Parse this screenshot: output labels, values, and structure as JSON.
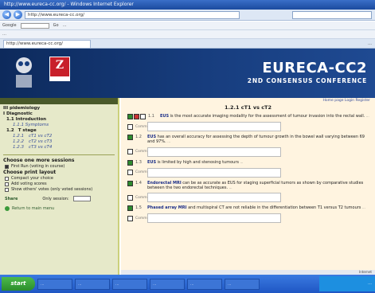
{
  "window": {
    "title": "http://www.eureca-cc.org/ - Windows Internet Explorer",
    "address": "http://www.eureca-cc.org/",
    "tab_label": "http://www.eureca-cc.org/"
  },
  "toolbar": {
    "row1": [
      "Google",
      "Go",
      "…"
    ],
    "row2": [
      "…"
    ],
    "tab_tools": "…"
  },
  "header": {
    "logo_ze_text": "Z",
    "title": "EURECA-CC2",
    "subtitle": "2ND CONSENSUS CONFERENCE"
  },
  "sidebar": {
    "section_header": "",
    "rows": [
      {
        "text": "III pidemiology",
        "level": 1
      },
      {
        "text": "I Diagnostic",
        "level": 1
      },
      {
        "text": "1.1 Introduction",
        "level": 2
      },
      {
        "text": "1.1.1 Symptoms",
        "level": 3
      }
    ],
    "stage_label": "1.2",
    "stage_title": "T stage",
    "stage_items": [
      {
        "num": "1.2.1",
        "label": "cT1 vs cT2"
      },
      {
        "num": "1.2.2",
        "label": "cT2 vs cT3"
      },
      {
        "num": "1.2.3",
        "label": "cT3 vs cT4"
      }
    ],
    "choose_sessions": "Choose one more sessions",
    "first_run": "First Run (voting in course)",
    "print_layout": "Choose print layout",
    "print_options": [
      {
        "label": "Compact your choice",
        "checked": false
      },
      {
        "label": "Add voting scores",
        "checked": false
      },
      {
        "label": "Show others' votes (only voted sessions)",
        "checked": false
      }
    ],
    "share_label": "Share",
    "only_session_label": "Only session:",
    "return_label": "Return to main menu"
  },
  "main": {
    "links": "Home page   Login   Register",
    "section_title": "1.2.1 cT1 vs cT2",
    "comment_label": "Comment",
    "statements": [
      {
        "num": "1.1",
        "highlight": "EUS",
        "text": " is the most accurate imaging modality for the assessment of tumour invasion into the rectal wall.",
        "refs": "…",
        "votes": [
          "g",
          "r",
          "w"
        ]
      },
      {
        "num": "1.2",
        "highlight": "EUS",
        "text": " has an overall accuracy for assessing the depth of tumour growth in the bowel wall varying between 69 and 97%.",
        "refs": "…",
        "votes": [
          "g",
          "w",
          "w"
        ]
      },
      {
        "num": "1.3",
        "highlight": "EUS",
        "text": " is limited by high and stenosing tumours",
        "refs": "…",
        "votes": [
          "g",
          "w",
          "w"
        ]
      },
      {
        "num": "1.4",
        "highlight": "Endorectal MRI",
        "text": " can be as accurate as EUS for staging superficial tumors as shown by comparative studies between the two endorectal techniques.",
        "refs": "…",
        "votes": [
          "g",
          "w",
          "w"
        ]
      },
      {
        "num": "1.5",
        "highlight": "Phased array MRI",
        "text": " and multispiral CT are not reliable in the differentiation between T1 versus T2 tumours",
        "refs": "…",
        "votes": [
          "g",
          "w",
          "w"
        ]
      }
    ]
  },
  "statusbar": {
    "text": "Internet"
  },
  "taskbar": {
    "start_label": "start",
    "tasks": [
      "…",
      "…",
      "…",
      "…",
      "…",
      "…"
    ],
    "tray": "…"
  },
  "colors": {
    "header_bg": "#173d7e",
    "sidebar_bg": "#e6e9c9",
    "main_bg": "#fff4e0",
    "vote_green": "#2e8b2e",
    "vote_red": "#cc3333",
    "highlight_text": "#1a2e88"
  }
}
